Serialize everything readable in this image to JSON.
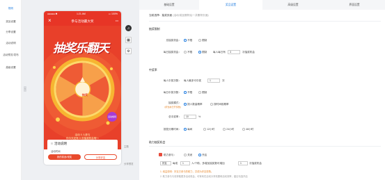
{
  "left_nav": {
    "items": [
      "规则",
      "奖品设置",
      "分享设置",
      "活动说明",
      "活动预览/发布",
      "高级设置"
    ]
  },
  "phone": {
    "status": {
      "carrier": "●●●●● ✱",
      "time": "1:21 AM",
      "battery": "▭ 100%"
    },
    "title": "参与活动赢大奖",
    "headline": "抽奖乐翻天",
    "wheel": {
      "center": "抽奖",
      "rule_badge": "活动规则"
    },
    "tip_1": "活动 0 人参与",
    "tip_2": "你今天还有 0 次抽奖机会哦～",
    "tip_3": "▽ 快乐中奖之后得到 ▽",
    "card_title": "活动说明",
    "card_sub": "活动时间",
    "btn_left": "我的奖品/领奖",
    "btn_right": "分享好友",
    "colors": {
      "primary": "#e73526",
      "wheel_outer": "#f7b531",
      "button": "#e94a2c"
    }
  },
  "side_icons": {
    "top": [
      "music-icon",
      "qr-icon",
      "settings-icon"
    ],
    "labels": [
      "主题",
      "分享预览"
    ]
  },
  "tabs": [
    "基础设置",
    "奖品设置",
    "高级设置",
    "界面设置"
  ],
  "active_tab": 1,
  "content": {
    "bread_label": "当前选择：抽奖页面",
    "bread_tip": "(活动/奖品删除后一并删除页面)",
    "section_1": "抽奖限制",
    "total_limit_label": "总抽奖机会：",
    "total_opts": [
      "不限",
      "限制"
    ],
    "daily_limit_label": "每日抽奖机会：",
    "daily_opts": [
      "不限",
      "限制"
    ],
    "daily_prefix": "每人每日有",
    "daily_value": "3",
    "daily_suffix": "次抽奖机会",
    "section_2": "中奖率",
    "win_max_label": "每人中奖次数：",
    "win_max_prefix": "每人最多可中奖",
    "win_max_value": "1",
    "win_max_suffix": "次",
    "daily_win_label": "每日中奖次数：",
    "daily_win_opts": [
      "不限",
      "限制"
    ],
    "mode_label": "抽奖模式：",
    "mode_hint": "(按当前已开奖数)",
    "mode_opts": [
      "按人数量概率",
      "按时间段概率"
    ],
    "rate_label": "总中奖率：",
    "rate_value": "10",
    "rate_unit": "%",
    "period_label": "按混分期时间：",
    "period_opts": [
      "每间",
      "12小时",
      "24小时",
      "48小时"
    ],
    "section_3": "助力抽奖机会",
    "boost_label": "助力参与：",
    "boost_opts": [
      "关闭",
      "开启"
    ],
    "boost_row_1": "好友",
    "boost_row_2": "每成",
    "boost_value": "1",
    "boost_mid": "人/个助，多增加抽奖数可增加",
    "boost_value2": "1",
    "boost_tail": "次抽奖机会",
    "note_1": "1. 增益说明：好友已参与的助力，并成为好友视角。",
    "note_2": "2. 助力参与与将获取更多活动机会，可有利在活动分享效果和活动效率，建议勾选开启"
  }
}
